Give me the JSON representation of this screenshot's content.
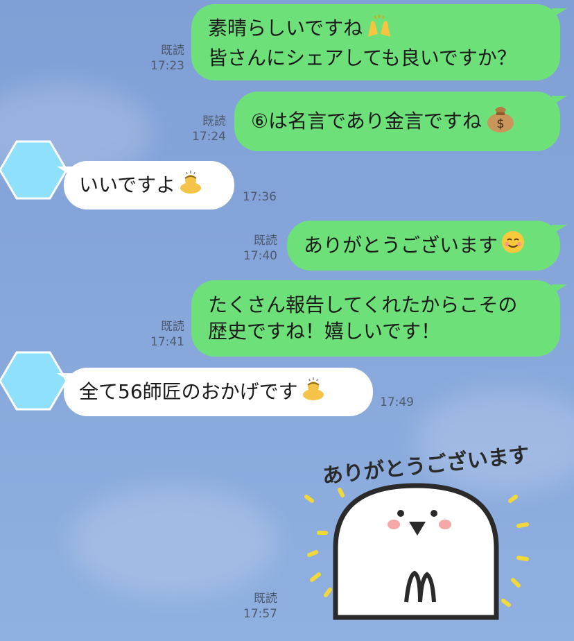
{
  "messages": [
    {
      "id": "m1",
      "dir": "out",
      "lines": [
        "素晴らしいですね",
        "皆さんにシェアしても良いですか？"
      ],
      "emoji": "raised-hands",
      "read": "既読",
      "time": "17:23"
    },
    {
      "id": "m2",
      "dir": "out",
      "lines": [
        "⑥は名言であり金言ですね"
      ],
      "emoji": "money-bag",
      "read": "既読",
      "time": "17:24"
    },
    {
      "id": "m3",
      "dir": "in",
      "lines": [
        "いいですよ"
      ],
      "emoji": "bowing-person",
      "time": "17:36"
    },
    {
      "id": "m4",
      "dir": "out",
      "lines": [
        "ありがとうございます"
      ],
      "emoji": "smiling-face",
      "read": "既読",
      "time": "17:40"
    },
    {
      "id": "m5",
      "dir": "out",
      "lines": [
        "たくさん報告してくれたからこその",
        "歴史ですね！嬉しいです！"
      ],
      "read": "既読",
      "time": "17:41"
    },
    {
      "id": "m6",
      "dir": "in",
      "lines": [
        "全て56師匠のおかげです"
      ],
      "emoji": "bowing-person",
      "time": "17:49"
    },
    {
      "id": "m7",
      "dir": "out",
      "sticker": "ありがとうございます",
      "read": "既読",
      "time": "17:57"
    }
  ],
  "colors": {
    "outgoing": "#6ee07a",
    "incoming": "#ffffff",
    "background": "#86a5da",
    "avatar": "#8fe0fb"
  }
}
